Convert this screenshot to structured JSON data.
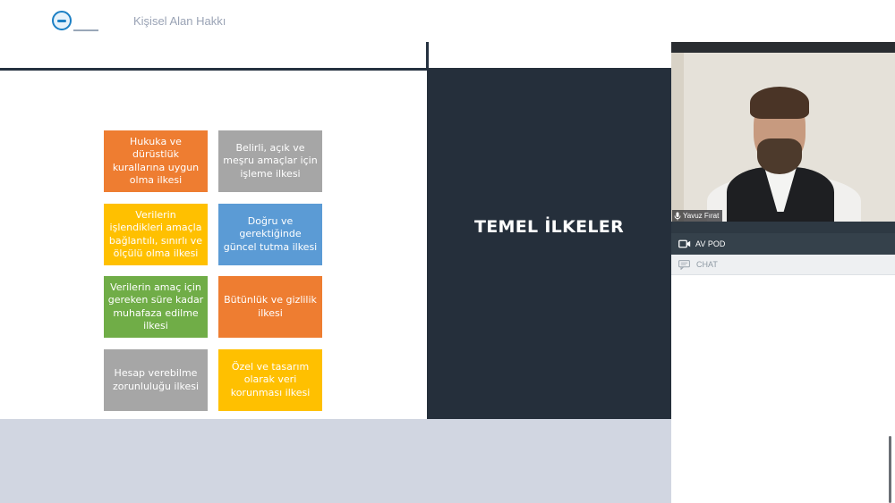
{
  "app": {
    "title": "Kişisel Alan Hakkı"
  },
  "slide": {
    "heading": "TEMEL İLKELER",
    "principles": [
      {
        "text": "Hukuka ve dürüstlük kurallarına uygun olma ilkesi",
        "color": "#ee7d31"
      },
      {
        "text": "Belirli, açık ve meşru amaçlar için işleme ilkesi",
        "color": "#a6a6a6"
      },
      {
        "text": "Verilerin işlendikleri amaçla bağlantılı, sınırlı ve ölçülü olma ilkesi",
        "color": "#ffc000"
      },
      {
        "text": "Doğru ve gerektiğinde güncel tutma ilkesi",
        "color": "#5b9bd5"
      },
      {
        "text": "Verilerin amaç için gereken süre kadar muhafaza edilme ilkesi",
        "color": "#70ad47"
      },
      {
        "text": "Bütünlük ve gizlilik ilkesi",
        "color": "#ee7d31"
      },
      {
        "text": "Hesap verebilme zorunluluğu ilkesi",
        "color": "#a6a6a6"
      },
      {
        "text": "Özel ve tasarım olarak veri korunması ilkesi",
        "color": "#ffc000"
      }
    ]
  },
  "video": {
    "participant_name": "Yavuz Fırat"
  },
  "pods": {
    "av_pod_label": "AV POD",
    "chat_label": "CHAT"
  },
  "icons": {
    "logo": "organization-logo",
    "mic": "microphone-icon",
    "camera": "video-camera-icon",
    "chat": "chat-bubble-icon"
  },
  "colors": {
    "slide_dark_panel": "#252f3b",
    "av_pod_header": "#35414b",
    "stage_background": "#d1d6e1"
  }
}
